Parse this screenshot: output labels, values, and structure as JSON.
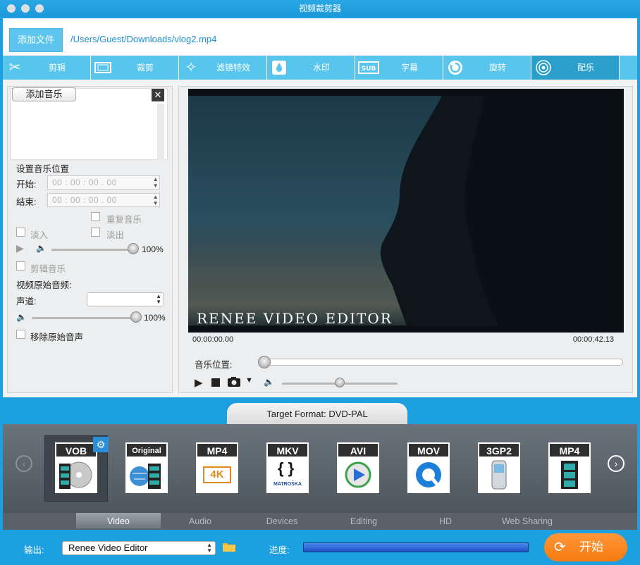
{
  "window": {
    "title": "视频裁剪器"
  },
  "file": {
    "add_label": "添加文件",
    "path": "/Users/Guest/Downloads/vlog2.mp4"
  },
  "toolbar": [
    {
      "label": "剪辑",
      "icon": "scissors-icon"
    },
    {
      "label": "裁剪",
      "icon": "crop-icon"
    },
    {
      "label": "滤镜特效",
      "icon": "stars-icon"
    },
    {
      "label": "水印",
      "icon": "droplet-icon"
    },
    {
      "label": "字幕",
      "icon": "subtitle-icon"
    },
    {
      "label": "旋转",
      "icon": "rotate-icon"
    },
    {
      "label": "配乐",
      "icon": "music-icon"
    }
  ],
  "music": {
    "add_label": "添加音乐",
    "position_label": "设置音乐位置",
    "start_label": "开始:",
    "end_label": "结束:",
    "start_value": "00 : 00 : 00 . 00",
    "end_value": "00 : 00 : 00 . 00",
    "repeat_label": "重复音乐",
    "fadein_label": "淡入",
    "fadeout_label": "淡出",
    "volume_value": "100%",
    "volume_level": 1.0,
    "clip_label": "剪辑音乐",
    "orig_audio_label": "视频原始音频:",
    "channel_label": "声道:",
    "channel_value": "",
    "orig_volume_value": "100%",
    "orig_volume_level": 1.0,
    "remove_label": "移除原始音声"
  },
  "preview": {
    "watermark": "RENEE VIDEO EDITOR",
    "time_start": "00:00:00.00",
    "time_end": "00:00:42.13",
    "music_position_label": "音乐位置:",
    "music_position_level": 0.0,
    "player_volume_level": 0.5
  },
  "format": {
    "target_label": "Target Format: DVD-PAL",
    "items": [
      {
        "tag": "VOB",
        "selected": true
      },
      {
        "tag": "Original"
      },
      {
        "tag": "MP4",
        "badge": "4K"
      },
      {
        "tag": "MKV",
        "badge": "MATROŠKA"
      },
      {
        "tag": "AVI"
      },
      {
        "tag": "MOV"
      },
      {
        "tag": "3GP2"
      },
      {
        "tag": "MP4"
      }
    ],
    "tabs": [
      "Video",
      "Audio",
      "Devices",
      "Editing",
      "HD",
      "Web Sharing"
    ],
    "active_tab": "Video"
  },
  "output": {
    "label": "输出:",
    "value": "Renee Video Editor",
    "progress_label": "进度:",
    "progress": 1.0,
    "start_label": "开始"
  },
  "colors": {
    "accent": "#1da0e0",
    "toolbar": "#57c5ec",
    "start": "#f7861f"
  }
}
